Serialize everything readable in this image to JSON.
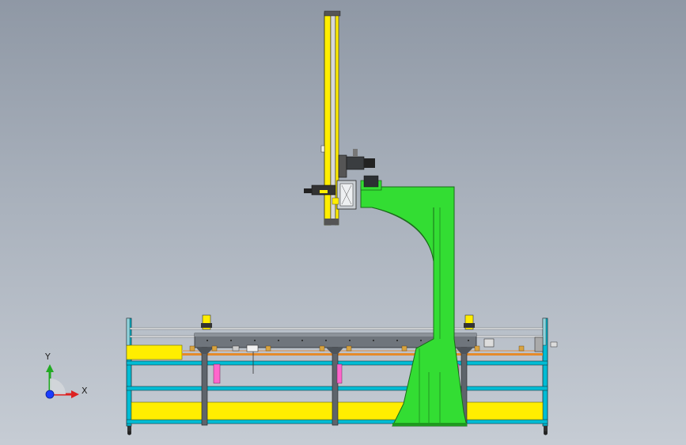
{
  "view": {
    "kind": "cad-model-viewport",
    "background": [
      "#8f98a5",
      "#c6ccd4"
    ]
  },
  "colors": {
    "frame": "#00bcd4",
    "frame_dark": "#008fa3",
    "yellow": "#ffee00",
    "green": "#33dd33",
    "green_dark": "#1f9a1f",
    "rail": "#5e646b",
    "pink": "#ff66cc",
    "orange": "#e58a2a"
  },
  "triad": {
    "y_label": "Y",
    "x_label": "X",
    "y_color": "#22aa22",
    "x_color": "#dd2222",
    "origin_color": "#1a3cff"
  }
}
